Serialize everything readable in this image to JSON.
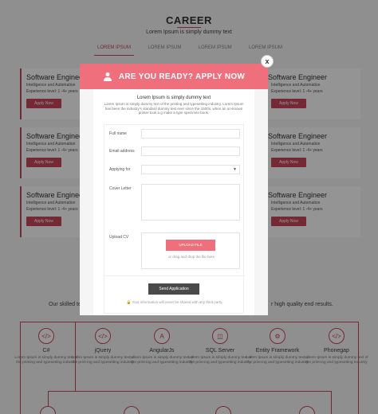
{
  "page": {
    "title": "CAREER",
    "subtitle": "Lorem Ipsum is simply dummy text",
    "tabs": [
      "LOREM IPSUM",
      "LOREM IPSUM",
      "LOREM IPSUM",
      "LOREM IPSUM"
    ]
  },
  "jobs": {
    "title": "Software Engineer",
    "line1": "Intelligence and Automation",
    "line2": "Experience level: 1 -4+ years",
    "apply_label": "Apply Now"
  },
  "skills_intro": {
    "left": "Our skilled te",
    "right": "r high quality end results."
  },
  "skills": [
    {
      "name": "C#",
      "icon": "csharp-icon",
      "desc": "Lorem Ipsum is simply dummy text of the printing and typesetting industry"
    },
    {
      "name": "jQuery",
      "icon": "jquery-icon",
      "desc": "Lorem Ipsum is simply dummy text of the print-ing and typesetting industry"
    },
    {
      "name": "AngularJs",
      "icon": "angularjs-icon",
      "desc": "Lorem Ipsum is simply dummy text of the print-ing and typesetting industry"
    },
    {
      "name": "SQL Server",
      "icon": "sql-server-icon",
      "desc": "Lorem Ipsum is simply dummy text of the print-ing and typesetting industry"
    },
    {
      "name": "Entity Framework",
      "icon": "entity-framework-icon",
      "desc": "Lorem Ipsum is simply dummy text of the print-ing and typesetting industry"
    },
    {
      "name": "Phonegap",
      "icon": "phonegap-icon",
      "desc": "Lorem Ipsum is simply dummy text of the print-ing and typesetting industry"
    }
  ],
  "modal": {
    "header": "ARE YOU READY? APPLY NOW",
    "title": "Lorem Ipsum is simply dummy text",
    "description": "Lorem Ipsum is simply dummy text of the printing and typesetting industry. Lorem Ipsum has been the industry's standard dummy text ever since the 1500s, when an un-known printer took a g make a type specimen book.",
    "fields": {
      "full_name": "Full name",
      "email": "Email address",
      "applying_for": "Applying for",
      "cover_letter": "Cover Letter",
      "upload_cv": "Upload CV"
    },
    "upload_button": "UPLOAD FILE",
    "upload_hint": "or drag and drop the file here",
    "send_button": "Send Application",
    "privacy_note": "Your information will never be shared with any third party.",
    "close_label": "x"
  },
  "colors": {
    "accent": "#c9475b",
    "modal_header": "#ef6f7c",
    "send_button": "#4a4a4a"
  }
}
